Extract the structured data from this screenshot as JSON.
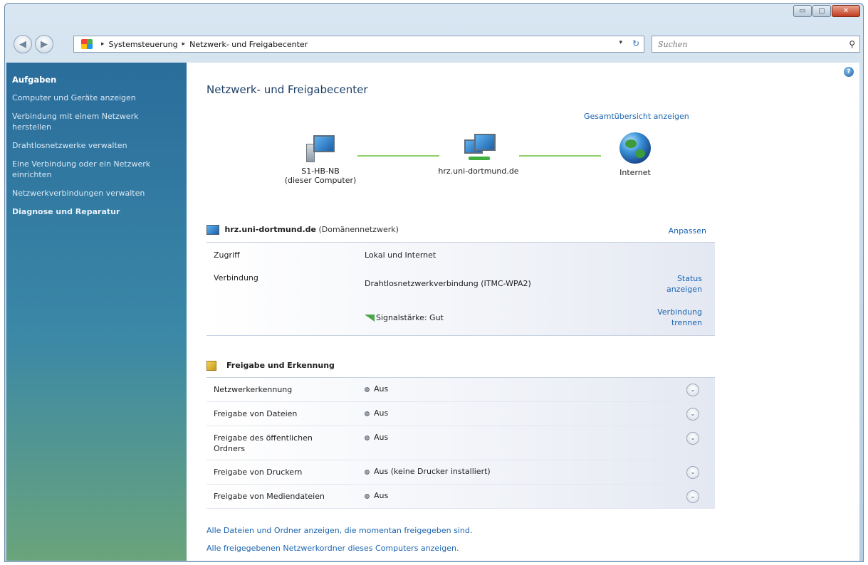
{
  "window": {
    "controls": {
      "minimize": "▭",
      "maximize": "▢",
      "close": "✕"
    }
  },
  "nav": {
    "back_icon": "◀",
    "forward_icon": "▶",
    "breadcrumb": [
      "Systemsteuerung",
      "Netzwerk- und Freigabecenter"
    ],
    "dropdown": "▾",
    "refresh": "↻",
    "search_placeholder": "Suchen",
    "search_icon": "⚲"
  },
  "sidebar": {
    "heading": "Aufgaben",
    "items": [
      "Computer und Geräte anzeigen",
      "Verbindung mit einem Netzwerk herstellen",
      "Drahtlosnetzwerke verwalten",
      "Eine Verbindung oder ein Netzwerk einrichten",
      "Netzwerkverbindungen verwalten",
      "Diagnose und Reparatur"
    ]
  },
  "main": {
    "help": "?",
    "title": "Netzwerk- und Freigabecenter",
    "overview_link": "Gesamtübersicht anzeigen",
    "map": {
      "computer_name": "S1-HB-NB",
      "computer_sub": "(dieser Computer)",
      "network_name": "hrz.uni-dortmund.de",
      "internet": "Internet"
    },
    "network": {
      "name": "hrz.uni-dortmund.de",
      "type": "(Domänennetzwerk)",
      "customize": "Anpassen",
      "access_label": "Zugriff",
      "access_value": "Lokal und Internet",
      "connection_label": "Verbindung",
      "connection_value": "Drahtlosnetzwerkverbindung (ITMC-WPA2)",
      "status_link_1": "Status",
      "status_link_2": "anzeigen",
      "signal": "Signalstärke: Gut",
      "disconnect_1": "Verbindung",
      "disconnect_2": "trennen"
    },
    "sharing": {
      "heading": "Freigabe und Erkennung",
      "expand_icon": "⌄",
      "rows": [
        {
          "label": "Netzwerkerkennung",
          "value": "Aus"
        },
        {
          "label": "Freigabe von Dateien",
          "value": "Aus"
        },
        {
          "label": "Freigabe des öffentlichen Ordners",
          "value": "Aus"
        },
        {
          "label": "Freigabe von Druckern",
          "value": "Aus (keine Drucker installiert)"
        },
        {
          "label": "Freigabe von Mediendateien",
          "value": "Aus"
        }
      ]
    },
    "footer_links": [
      "Alle Dateien und Ordner anzeigen, die momentan freigegeben sind.",
      "Alle freigegebenen Netzwerkordner dieses Computers anzeigen."
    ]
  }
}
